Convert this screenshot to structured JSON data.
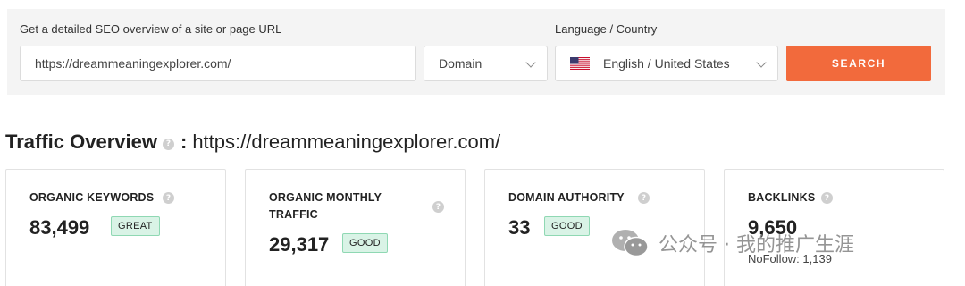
{
  "search": {
    "url_label": "Get a detailed SEO overview of a site or page URL",
    "url_value": "https://dreammeaningexplorer.com/",
    "scope_selected": "Domain",
    "lang_label": "Language / Country",
    "lang_selected": "English / United States",
    "button_label": "SEARCH"
  },
  "overview": {
    "title": "Traffic Overview",
    "colon": ":",
    "url": "https://dreammeaningexplorer.com/"
  },
  "cards": [
    {
      "label": "ORGANIC KEYWORDS",
      "value": "83,499",
      "badge": "GREAT"
    },
    {
      "label": "ORGANIC MONTHLY TRAFFIC",
      "value": "29,317",
      "badge": "GOOD"
    },
    {
      "label": "DOMAIN AUTHORITY",
      "value": "33",
      "badge": "GOOD"
    },
    {
      "label": "BACKLINKS",
      "value": "9,650",
      "sub": "NoFollow: 1,139"
    }
  ],
  "watermark": {
    "text": "公众号 · 我的推广生涯"
  },
  "colors": {
    "accent": "#f26a3c",
    "badge_bg": "#d9f3e6",
    "badge_border": "#8fd8b3",
    "panel_bg": "#f4f4f4"
  },
  "icons": [
    "help-icon",
    "chevron-down-icon",
    "us-flag-icon",
    "wechat-icon"
  ]
}
